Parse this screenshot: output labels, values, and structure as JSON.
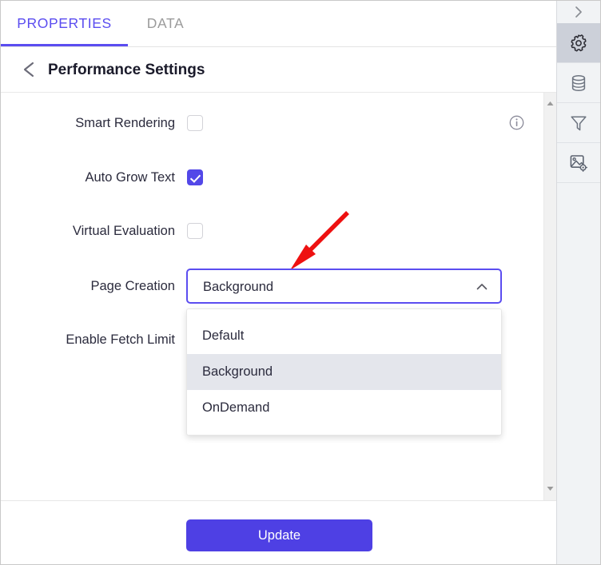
{
  "window": {
    "accent_color": "#5b4df0",
    "checkbox_checked_color": "#5348e8",
    "button_color": "#4e40e4",
    "annotation_arrow_color": "#ee1111",
    "rail_active_color": "#ccd0d9"
  },
  "tabs": [
    {
      "label": "PROPERTIES",
      "active": true
    },
    {
      "label": "DATA",
      "active": false
    }
  ],
  "header": {
    "back_icon": "chevron-left-icon",
    "title": "Performance Settings"
  },
  "form": {
    "rows": [
      {
        "label": "Smart Rendering",
        "control": "checkbox",
        "checked": false,
        "info": true
      },
      {
        "label": "Auto Grow Text",
        "control": "checkbox",
        "checked": true,
        "info": false
      },
      {
        "label": "Virtual Evaluation",
        "control": "checkbox",
        "checked": false,
        "info": false
      },
      {
        "label": "Page Creation",
        "control": "select",
        "checked": false,
        "info": false
      },
      {
        "label": "Enable Fetch Limit",
        "control": "checkbox",
        "checked": false,
        "info": false
      }
    ]
  },
  "page_creation_select": {
    "value": "Background",
    "expanded": true,
    "caret_icon": "chevron-up-icon",
    "options": [
      {
        "label": "Default",
        "selected": false
      },
      {
        "label": "Background",
        "selected": true
      },
      {
        "label": "OnDemand",
        "selected": false
      }
    ]
  },
  "scrollbar": {
    "up_arrow_icon": "triangle-up-icon",
    "down_arrow_icon": "triangle-down-icon"
  },
  "footer": {
    "update_label": "Update"
  },
  "rail": {
    "items": [
      {
        "icon": "chevron-right-icon",
        "name": "expand-panel",
        "active": false
      },
      {
        "icon": "gear-icon",
        "name": "settings",
        "active": true
      },
      {
        "icon": "database-icon",
        "name": "data-source",
        "active": false
      },
      {
        "icon": "filter-funnel-icon",
        "name": "filter",
        "active": false
      },
      {
        "icon": "image-settings-icon",
        "name": "image-settings",
        "active": false
      }
    ]
  },
  "annotation": {
    "type": "arrow",
    "points_to": "page-creation-select"
  }
}
